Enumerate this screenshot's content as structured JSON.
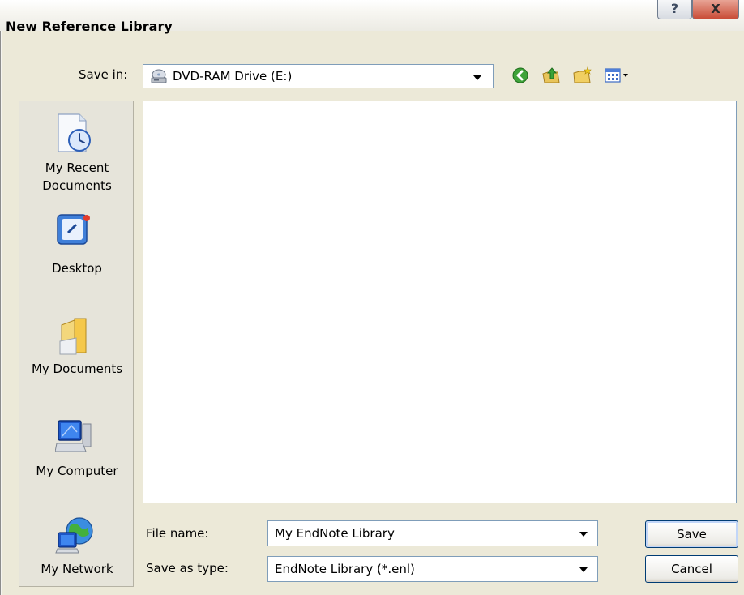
{
  "window": {
    "title": "New Reference Library",
    "help_label": "?",
    "close_label": "X"
  },
  "toolbar": {
    "save_in_label": "Save in:",
    "save_in_value": "DVD-RAM Drive (E:)",
    "icons": [
      "back-icon",
      "up-folder-icon",
      "new-folder-icon",
      "views-menu-icon"
    ]
  },
  "places": [
    {
      "label_line1": "My Recent",
      "label_line2": "Documents",
      "icon": "recent-documents-icon"
    },
    {
      "label_line1": "Desktop",
      "icon": "desktop-icon"
    },
    {
      "label_line1": "My Documents",
      "icon": "my-documents-icon"
    },
    {
      "label_line1": "My Computer",
      "icon": "my-computer-icon"
    },
    {
      "label_line1": "My Network",
      "icon": "my-network-icon"
    }
  ],
  "form": {
    "file_name_label": "File name:",
    "file_name_value": "My EndNote Library",
    "save_as_type_label": "Save as type:",
    "save_as_type_value": "EndNote Library (*.enl)"
  },
  "buttons": {
    "save": "Save",
    "cancel": "Cancel"
  },
  "colors": {
    "dialog_bg": "#ece9d8",
    "field_border": "#7f9db9",
    "default_button_ring": "#c2d6f8"
  }
}
